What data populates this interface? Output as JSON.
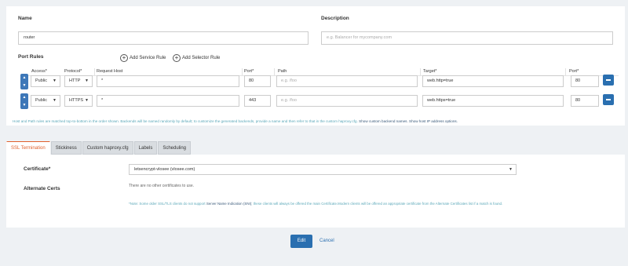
{
  "form": {
    "name_label": "Name",
    "name_value": "router",
    "description_label": "Description",
    "description_placeholder": "e.g. Balancer for mycompany.com"
  },
  "port_rules": {
    "title": "Port Rules",
    "add_service_rule": "Add Service Rule",
    "add_selector_rule": "Add Selector Rule",
    "headers": {
      "access": "Access*",
      "protocol": "Protocol*",
      "request_host": "Request Host",
      "port": "Port*",
      "path": "Path",
      "target": "Target*",
      "target_port": "Port*"
    },
    "rows": [
      {
        "access": "Public",
        "protocol": "HTTP",
        "request_host": "*",
        "port": "80",
        "path_placeholder": "e.g. /foo",
        "target": "web.http=true",
        "target_port": "80"
      },
      {
        "access": "Public",
        "protocol": "HTTPS",
        "request_host": "*",
        "port": "443",
        "path_placeholder": "e.g. /foo",
        "target": "web.https=true",
        "target_port": "80"
      }
    ],
    "help_text": "Host and Path rules are matched top-to-bottom in the order shown. Backends will be named randomly by default; to customize the generated backends, provide a name and then refer to that in the custom haproxy.cfg.",
    "help_link_1": "Show custom backend names.",
    "help_link_2": "Show host IP address options."
  },
  "tabs": [
    "SSL Termination",
    "Stickiness",
    "Custom haproxy.cfg",
    "Labels",
    "Scheduling"
  ],
  "ssl": {
    "certificate_label": "Certificate*",
    "certificate_value": "letsencrypt-vlosee (vlosee.com)",
    "alternate_label": "Alternate Certs",
    "no_other_certs": "There are no other certificates to use.",
    "note_prefix": "*Note: Some older SSL/TLS clients do not support",
    "note_link": "Server Name Indication (SNI)",
    "note_suffix": "; these clients will always be offered the main Certificate.Modern clients will be offered an appropriate certificate from the Alternate Certificates list if a match is found."
  },
  "actions": {
    "edit": "Edit",
    "cancel": "Cancel"
  },
  "colors": {
    "primary": "#2a6fb0",
    "active_tab": "#e05f2c",
    "help_text": "#5aa7b8"
  }
}
